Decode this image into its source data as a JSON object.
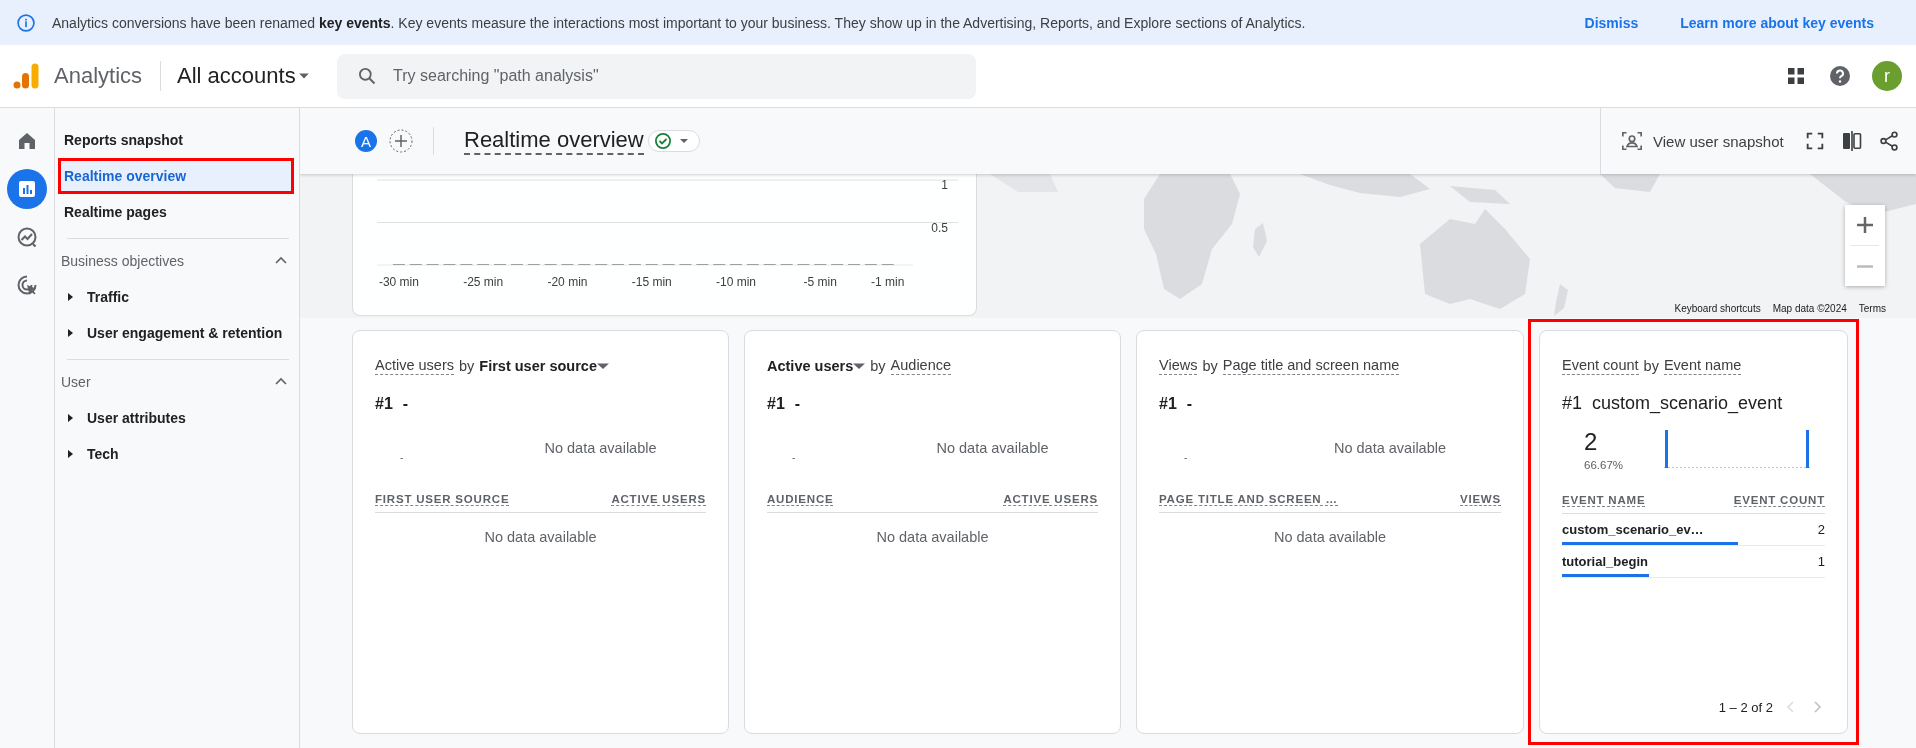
{
  "banner": {
    "message": "Analytics conversions have been renamed **key events**. Key events measure the interactions most important to your business. They show up in the Advertising, Reports, and Explore sections of Analytics.",
    "actions": [
      "Dismiss",
      "Learn more about key events"
    ]
  },
  "topbar": {
    "product": "Analytics",
    "account": "All accounts",
    "search": {
      "placeholder": "Try searching \"path analysis\""
    },
    "avatar": "r"
  },
  "rail": [
    {
      "kind": "home",
      "selected": false
    },
    {
      "kind": "reports",
      "selected": true
    },
    {
      "kind": "explore",
      "selected": false
    },
    {
      "kind": "advertising",
      "selected": false
    }
  ],
  "sidebar": {
    "items": [
      {
        "label": "Reports snapshot",
        "selected": false,
        "highlighted": false
      },
      {
        "label": "Realtime overview",
        "selected": true,
        "highlighted": true
      },
      {
        "label": "Realtime pages",
        "selected": false,
        "highlighted": false
      }
    ],
    "sections": [
      {
        "title": "Business objectives",
        "expanded": true,
        "items": [
          {
            "label": "Traffic",
            "expanded": false
          },
          {
            "label": "User engagement & retention",
            "expanded": false
          }
        ]
      },
      {
        "title": "User",
        "expanded": true,
        "items": [
          {
            "label": "User attributes",
            "expanded": false
          },
          {
            "label": "Tech",
            "expanded": false
          }
        ]
      }
    ]
  },
  "header": {
    "comparison": "A",
    "title": "Realtime overview",
    "healthy": true,
    "snapshot_button": "View user snapshot"
  },
  "map": {
    "attribution": [
      "Keyboard shortcuts",
      "Map data ©2024",
      "Terms"
    ]
  },
  "timeline": {
    "chart_data": {
      "type": "bar",
      "x": [
        -30,
        -29,
        -28,
        -27,
        -26,
        -25,
        -24,
        -23,
        -22,
        -21,
        -20,
        -19,
        -18,
        -17,
        -16,
        -15,
        -14,
        -13,
        -12,
        -11,
        -10,
        -9,
        -8,
        -7,
        -6,
        -5,
        -4,
        -3,
        -2,
        -1
      ],
      "values": [
        0,
        0,
        0,
        0,
        0,
        0,
        0,
        0,
        0,
        0,
        0,
        0,
        0,
        0,
        0,
        0,
        0,
        0,
        0,
        0,
        0,
        0,
        0,
        0,
        0,
        0,
        0,
        0,
        0,
        0
      ],
      "xticks": [
        {
          "value": -30,
          "label": "-30 min"
        },
        {
          "value": -25,
          "label": "-25 min"
        },
        {
          "value": -20,
          "label": "-20 min"
        },
        {
          "value": -15,
          "label": "-15 min"
        },
        {
          "value": -10,
          "label": "-10 min"
        },
        {
          "value": -5,
          "label": "-5 min"
        },
        {
          "value": -1,
          "label": "-1 min"
        }
      ],
      "xlim": [
        -31.3,
        0.5
      ],
      "yticks": [
        0.5,
        1
      ],
      "ylim": [
        0,
        1
      ]
    }
  },
  "cards": [
    {
      "title": [
        {
          "text": "Active users",
          "kind": "link"
        },
        {
          "text": "by",
          "kind": "plain"
        },
        {
          "text": "First user source",
          "kind": "dropdown"
        }
      ],
      "rank": "#1",
      "top_item": "-",
      "chart": {
        "kind": "empty",
        "placeholder": "-",
        "message": "No data available"
      },
      "columns": [
        "FIRST USER SOURCE",
        "ACTIVE USERS"
      ],
      "empty_message": "No data available",
      "highlighted": false
    },
    {
      "title": [
        {
          "text": "Active users",
          "kind": "dropdown"
        },
        {
          "text": "by",
          "kind": "plain"
        },
        {
          "text": "Audience",
          "kind": "link"
        }
      ],
      "rank": "#1",
      "top_item": "-",
      "chart": {
        "kind": "empty",
        "placeholder": "-",
        "message": "No data available"
      },
      "columns": [
        "AUDIENCE",
        "ACTIVE USERS"
      ],
      "empty_message": "No data available",
      "highlighted": false
    },
    {
      "title": [
        {
          "text": "Views",
          "kind": "link"
        },
        {
          "text": "by",
          "kind": "plain"
        },
        {
          "text": "Page title and screen name",
          "kind": "link"
        }
      ],
      "rank": "#1",
      "top_item": "-",
      "chart": {
        "kind": "empty",
        "placeholder": "-",
        "message": "No data available"
      },
      "columns": [
        "PAGE TITLE AND SCREEN …",
        "VIEWS"
      ],
      "empty_message": "No data available",
      "highlighted": false
    },
    {
      "title": [
        {
          "text": "Event count",
          "kind": "link"
        },
        {
          "text": "by",
          "kind": "plain"
        },
        {
          "text": "Event name",
          "kind": "link"
        }
      ],
      "rank": "#1",
      "top_item": "custom_scenario_event",
      "chart": {
        "kind": "sparkline",
        "value": "2",
        "percent": "66.67%"
      },
      "columns": [
        "EVENT NAME",
        "EVENT COUNT"
      ],
      "rows": [
        {
          "name": "custom_scenario_ev…",
          "value": "2",
          "level": 0.67
        },
        {
          "name": "tutorial_begin",
          "value": "1",
          "level": 0.33
        }
      ],
      "pagination": "1 – 2 of 2",
      "highlighted": true
    }
  ]
}
